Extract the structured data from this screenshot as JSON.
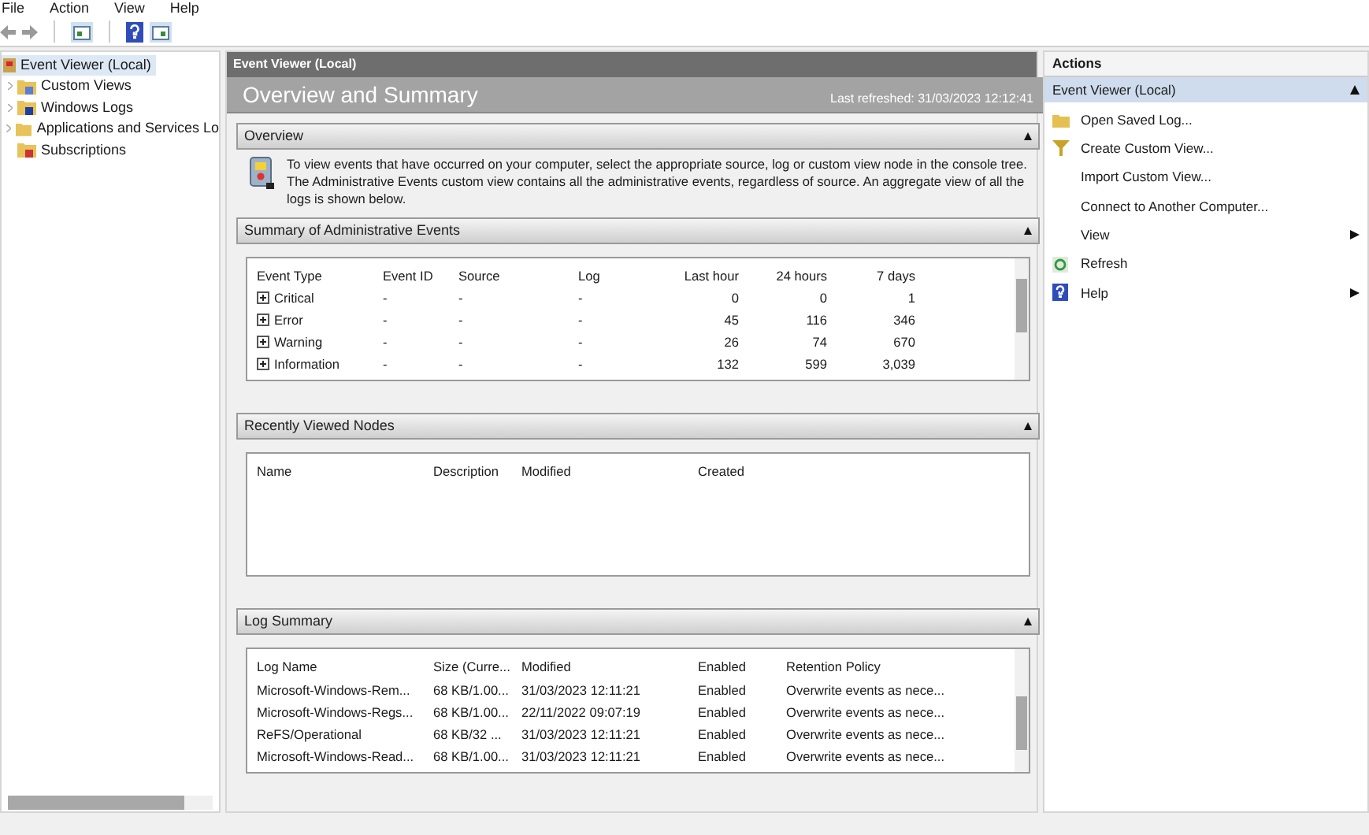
{
  "menu": [
    "File",
    "Action",
    "View",
    "Help"
  ],
  "tree": {
    "label": "Event Viewer (Local)",
    "selected": true,
    "children": [
      {
        "label": "Custom Views",
        "kind": "views",
        "expandable": true,
        "selected": false
      },
      {
        "label": "Windows Logs",
        "kind": "logs",
        "expandable": true,
        "selected": false
      },
      {
        "label": "Applications and Services Lo",
        "kind": "folder",
        "expandable": true,
        "selected": false
      },
      {
        "label": "Subscriptions",
        "kind": "subscriptions",
        "expandable": false,
        "selected": false
      }
    ]
  },
  "center": {
    "title": "Event Viewer (Local)",
    "heading": "Overview and Summary",
    "last_refreshed": "Last refreshed: 31/03/2023 12:12:41",
    "overview": {
      "title": "Overview",
      "expanded": true,
      "text": "To view events that have occurred on your computer, select the appropriate source, log or custom view node in the console tree. The Administrative Events custom view contains all the administrative events, regardless of source. An aggregate view of all the logs is shown below."
    },
    "summary": {
      "title": "Summary of Administrative Events",
      "expanded": true,
      "columns": [
        "Event Type",
        "Event ID",
        "Source",
        "Log",
        "Last hour",
        "24 hours",
        "7 days"
      ],
      "rows": [
        {
          "expanded": false,
          "cells": [
            "Critical",
            "-",
            "-",
            "-",
            "0",
            "0",
            "1"
          ]
        },
        {
          "expanded": false,
          "cells": [
            "Error",
            "-",
            "-",
            "-",
            "45",
            "116",
            "346"
          ]
        },
        {
          "expanded": false,
          "cells": [
            "Warning",
            "-",
            "-",
            "-",
            "26",
            "74",
            "670"
          ]
        },
        {
          "expanded": false,
          "cells": [
            "Information",
            "-",
            "-",
            "-",
            "132",
            "599",
            "3,039"
          ]
        }
      ]
    },
    "recent": {
      "title": "Recently Viewed Nodes",
      "expanded": true,
      "columns": [
        "Name",
        "Description",
        "Modified",
        "Created"
      ]
    },
    "log_summary": {
      "title": "Log Summary",
      "expanded": true,
      "columns": [
        "Log Name",
        "Size (Curre...",
        "Modified",
        "Enabled",
        "Retention Policy"
      ],
      "rows": [
        [
          "Microsoft-Windows-Rem...",
          "68 KB/1.00...",
          "31/03/2023 12:11:21",
          "Enabled",
          "Overwrite events as nece..."
        ],
        [
          "Microsoft-Windows-Regs...",
          "68 KB/1.00...",
          "22/11/2022 09:07:19",
          "Enabled",
          "Overwrite events as nece..."
        ],
        [
          "ReFS/Operational",
          "68 KB/32 ...",
          "31/03/2023 12:11:21",
          "Enabled",
          "Overwrite events as nece..."
        ],
        [
          "Microsoft-Windows-Read...",
          "68 KB/1.00...",
          "31/03/2023 12:11:21",
          "Enabled",
          "Overwrite events as nece..."
        ]
      ]
    }
  },
  "actions": {
    "title": "Actions",
    "group": {
      "label": "Event Viewer (Local)",
      "expanded": true
    },
    "items": [
      {
        "label": "Open Saved Log...",
        "kind": "open",
        "submenu": false
      },
      {
        "label": "Create Custom View...",
        "kind": "filter",
        "submenu": false
      },
      {
        "label": "Import Custom View...",
        "kind": "none",
        "submenu": false
      },
      {
        "label": "Connect to Another Computer...",
        "kind": "none",
        "submenu": false
      },
      {
        "label": "View",
        "kind": "none",
        "submenu": true
      },
      {
        "label": "Refresh",
        "kind": "refresh",
        "submenu": false
      },
      {
        "label": "Help",
        "kind": "help",
        "submenu": true
      }
    ]
  }
}
